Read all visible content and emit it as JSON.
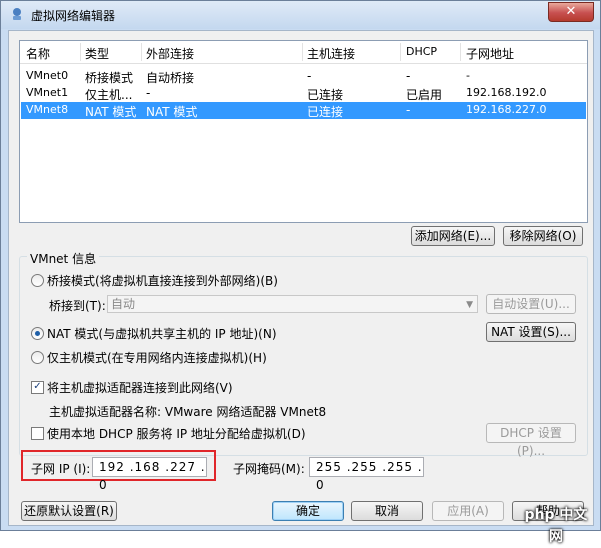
{
  "window": {
    "title": "虚拟网络编辑器",
    "close_glyph": "✕"
  },
  "table": {
    "headers": [
      "名称",
      "类型",
      "外部连接",
      "主机连接",
      "DHCP",
      "子网地址"
    ],
    "rows": [
      [
        "VMnet0",
        "桥接模式",
        "自动桥接",
        "-",
        "-",
        "-"
      ],
      [
        "VMnet1",
        "仅主机...",
        "-",
        "已连接",
        "已启用",
        "192.168.192.0"
      ],
      [
        "VMnet8",
        "NAT 模式",
        "NAT 模式",
        "已连接",
        "-",
        "192.168.227.0"
      ]
    ],
    "selected_row": 2
  },
  "buttons": {
    "add_network": "添加网络(E)...",
    "remove_network": "移除网络(O)",
    "auto_settings": "自动设置(U)...",
    "nat_settings": "NAT 设置(S)...",
    "dhcp_settings": "DHCP 设置(P)...",
    "restore_defaults": "还原默认设置(R)",
    "ok": "确定",
    "cancel": "取消",
    "apply": "应用(A)",
    "help": "帮助"
  },
  "vmnet_info": {
    "group_label": "VMnet 信息",
    "bridged_mode": "桥接模式(将虚拟机直接连接到外部网络)(B)",
    "bridged_to_label": "桥接到(T):",
    "bridged_to_value": "自动",
    "nat_mode": "NAT 模式(与虚拟机共享主机的 IP 地址)(N)",
    "host_only_mode": "仅主机模式(在专用网络内连接虚拟机)(H)",
    "selected_mode": "nat",
    "connect_adapter_label": "将主机虚拟适配器连接到此网络(V)",
    "connect_adapter_checked": true,
    "adapter_name_text": "主机虚拟适配器名称: VMware 网络适配器 VMnet8",
    "use_dhcp_label": "使用本地 DHCP 服务将 IP 地址分配给虚拟机(D)",
    "use_dhcp_checked": false
  },
  "subnet": {
    "ip_label": "子网 IP (I):",
    "ip_value": "192 .168 .227 . 0",
    "mask_label": "子网掩码(M):",
    "mask_value": "255 .255 .255 . 0"
  },
  "watermark": "php 中文网",
  "colors": {
    "selection": "#3399ff",
    "highlight_border": "#e0262a"
  }
}
